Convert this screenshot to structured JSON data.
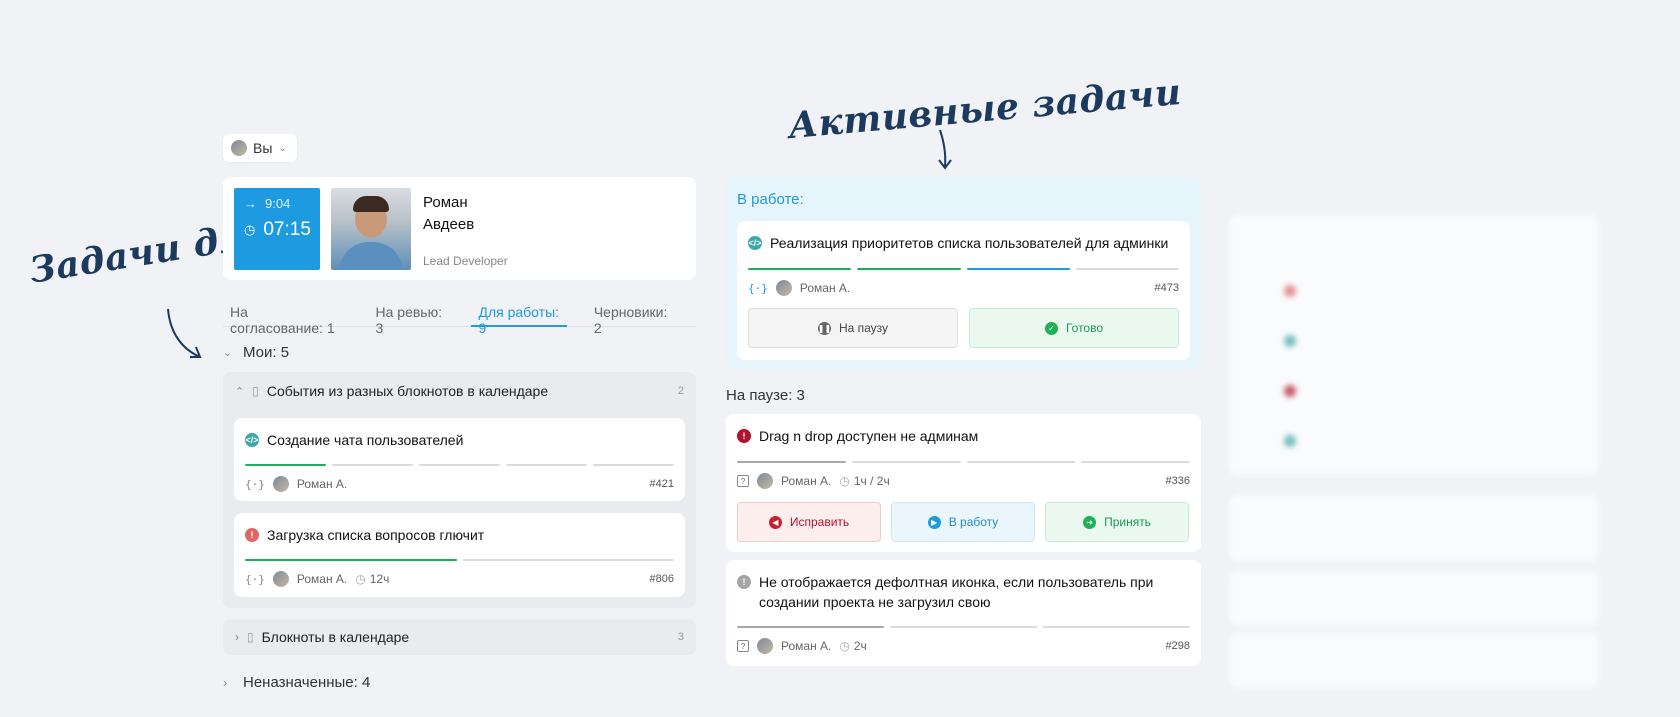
{
  "annotations": {
    "left": "Задачи для работы",
    "top": "Активные задачи"
  },
  "user_select": {
    "label": "Вы"
  },
  "profile": {
    "start_time": "9:04",
    "current_time": "07:15",
    "first_name": "Роман",
    "last_name": "Авдеев",
    "role": "Lead Developer"
  },
  "tabs": [
    {
      "label": "На согласование: 1"
    },
    {
      "label": "На ревью: 3"
    },
    {
      "label": "Для работы: 9"
    },
    {
      "label": "Черновики: 2"
    }
  ],
  "mine": {
    "header": "Мои: 5",
    "group1": {
      "title": "События из разных блокнотов в календаре",
      "count": "2",
      "tasks": [
        {
          "title": "Создание чата пользователей",
          "assignee": "Роман А.",
          "id": "#421"
        },
        {
          "title": "Загрузка списка вопросов глючит",
          "assignee": "Роман А.",
          "time": "12ч",
          "id": "#806"
        }
      ]
    },
    "group2": {
      "title": "Блокноты в календаре",
      "count": "3"
    }
  },
  "unassigned": {
    "header": "Неназначенные: 4"
  },
  "in_work": {
    "title": "В работе:",
    "task": {
      "title": "Реализация приоритетов списка пользователей для админки",
      "assignee": "Роман А.",
      "id": "#473"
    },
    "pause_label": "На паузу",
    "done_label": "Готово"
  },
  "paused": {
    "header": "На паузе: 3",
    "task1": {
      "title": "Drag n drop доступен не админам",
      "assignee": "Роман А.",
      "time": "1ч / 2ч",
      "id": "#336",
      "fix_label": "Исправить",
      "work_label": "В работу",
      "accept_label": "Принять"
    },
    "task2": {
      "title_line1": "Не отображается дефолтная иконка, если пользователь при",
      "title_line2": "создании проекта не загрузил свою",
      "assignee": "Роман А.",
      "time": "2ч",
      "id": "#298"
    }
  },
  "colors": {
    "accent": "#1e9be0",
    "success": "#1fb15a",
    "danger": "#b3142b",
    "annotation": "#1c3a5e"
  },
  "icons": [
    "chevron-down-icon",
    "arrow-right-icon",
    "clock-icon",
    "code-icon",
    "error-icon",
    "clipboard-icon",
    "pause-icon",
    "check-icon",
    "play-icon",
    "arrow-left-icon",
    "question-box-icon",
    "braces-icon"
  ]
}
